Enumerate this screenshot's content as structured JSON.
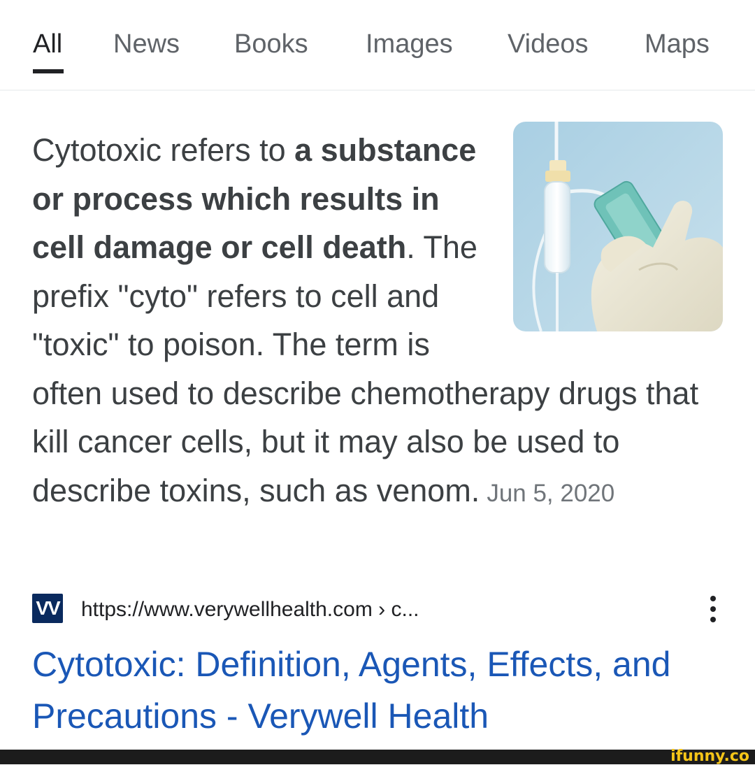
{
  "tabs": [
    {
      "label": "All",
      "active": true
    },
    {
      "label": "News"
    },
    {
      "label": "Books"
    },
    {
      "label": "Images"
    },
    {
      "label": "Videos"
    },
    {
      "label": "Maps"
    }
  ],
  "snippet": {
    "lead": "Cytotoxic refers to ",
    "highlight": "a substance or process which results in cell damage or cell death",
    "rest": ". The prefix \"cyto\" refers to cell and \"toxic\" to poison. The term is often used to describe chemotherapy drugs that kill cancer cells, but it may also be used to describe toxins, such as venom.",
    "date": "Jun 5, 2020",
    "image_icon": "iv-drip-bag-photo"
  },
  "source": {
    "favicon_letter": "VV",
    "url": "https://www.verywellhealth.com › c...",
    "more_icon": "more-vertical-icon"
  },
  "result": {
    "title": "Cytotoxic: Definition, Agents, Effects, and Precautions - Verywell Health"
  },
  "watermark": "ifunny.co",
  "colors": {
    "link": "#1a57b6",
    "text": "#3c4043",
    "tab_inactive": "#5f6368",
    "date": "#70757a"
  }
}
